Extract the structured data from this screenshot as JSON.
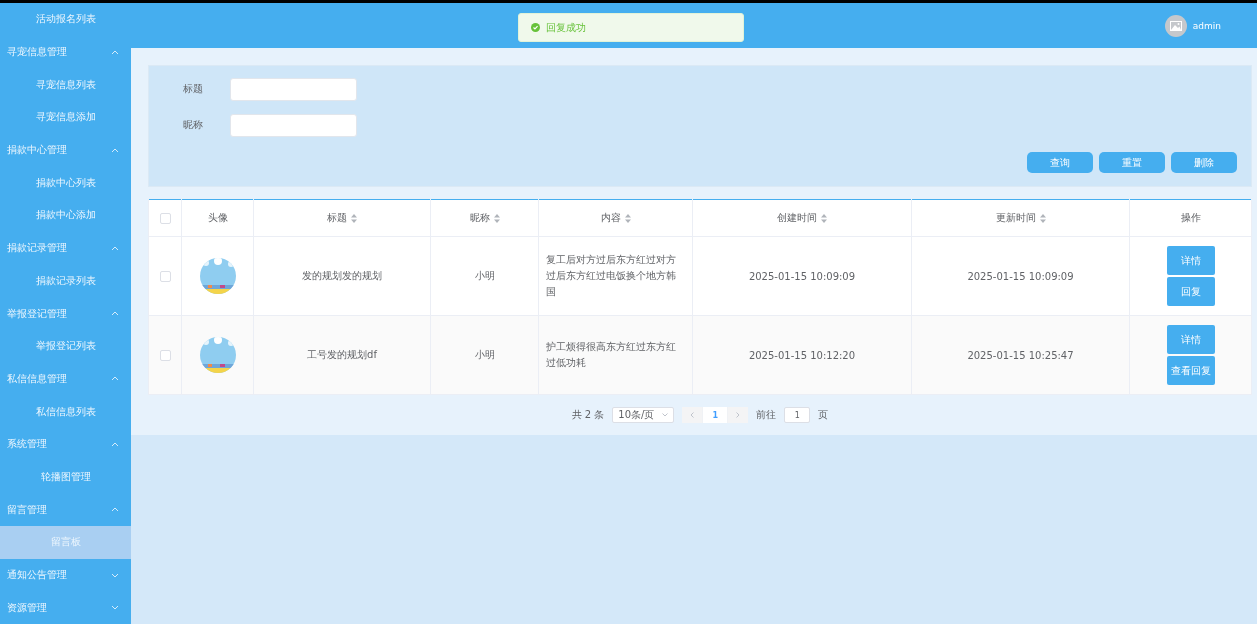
{
  "sidebar": {
    "items": [
      {
        "kind": "link",
        "label": "活动报名列表",
        "selected": false
      },
      {
        "kind": "group",
        "label": "寻宠信息管理",
        "expanded": true,
        "children": [
          {
            "label": "寻宠信息列表",
            "selected": false
          },
          {
            "label": "寻宠信息添加",
            "selected": false
          }
        ]
      },
      {
        "kind": "group",
        "label": "捐款中心管理",
        "expanded": true,
        "children": [
          {
            "label": "捐款中心列表",
            "selected": false
          },
          {
            "label": "捐款中心添加",
            "selected": false
          }
        ]
      },
      {
        "kind": "group",
        "label": "捐款记录管理",
        "expanded": true,
        "children": [
          {
            "label": "捐款记录列表",
            "selected": false
          }
        ]
      },
      {
        "kind": "group",
        "label": "举报登记管理",
        "expanded": true,
        "children": [
          {
            "label": "举报登记列表",
            "selected": false
          }
        ]
      },
      {
        "kind": "group",
        "label": "私信信息管理",
        "expanded": true,
        "children": [
          {
            "label": "私信信息列表",
            "selected": false
          }
        ]
      },
      {
        "kind": "group",
        "label": "系统管理",
        "expanded": true,
        "children": [
          {
            "label": "轮播图管理",
            "selected": false
          }
        ]
      },
      {
        "kind": "group",
        "label": "留言管理",
        "expanded": true,
        "children": [
          {
            "label": "留言板",
            "selected": true
          }
        ]
      },
      {
        "kind": "group",
        "label": "通知公告管理",
        "expanded": false
      },
      {
        "kind": "group",
        "label": "资源管理",
        "expanded": false
      }
    ]
  },
  "header": {
    "user": "admin"
  },
  "toast": {
    "message": "回复成功"
  },
  "search": {
    "fields": [
      {
        "label": "标题"
      },
      {
        "label": "昵称"
      }
    ],
    "buttons": [
      "查询",
      "重置",
      "删除"
    ]
  },
  "table": {
    "select_all": false,
    "columns": [
      {
        "label": "头像",
        "sortable": false
      },
      {
        "label": "标题",
        "sortable": true
      },
      {
        "label": "昵称",
        "sortable": true
      },
      {
        "label": "内容",
        "sortable": true
      },
      {
        "label": "创建时间",
        "sortable": true
      },
      {
        "label": "更新时间",
        "sortable": true
      },
      {
        "label": "操作",
        "sortable": false
      }
    ],
    "rows": [
      {
        "checked": false,
        "title": "发的规划发的规划",
        "nickname": "小明",
        "content": "复工后对方过后东方红过对方过后东方红过电饭换个地方韩国",
        "created": "2025-01-15 10:09:09",
        "updated": "2025-01-15 10:09:09",
        "actions": [
          "详情",
          "回复"
        ]
      },
      {
        "checked": false,
        "title": "工号发的规划df",
        "nickname": "小明",
        "content": "护工烦得很高东方红过东方红过低功耗",
        "created": "2025-01-15 10:12:20",
        "updated": "2025-01-15 10:25:47",
        "actions": [
          "详情",
          "查看回复"
        ]
      }
    ]
  },
  "pagination": {
    "total": "共 2 条",
    "page_size": "10条/页",
    "pages": [
      {
        "label": "1",
        "selected": true
      }
    ],
    "goto_label": "前往",
    "goto_value": "1",
    "page_suffix": "页"
  }
}
